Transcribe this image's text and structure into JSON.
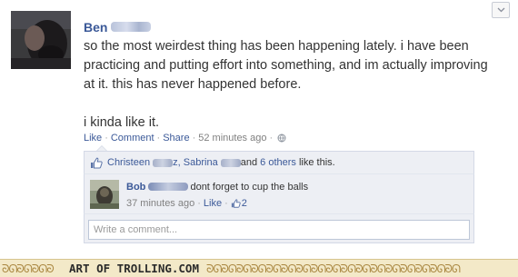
{
  "post": {
    "author_name": "Ben",
    "lines": [
      "so the most weirdest thing has been happening lately. i have been practicing and putting effort into something, and im actually improving at it. this has never happened before.",
      "i kinda like it."
    ],
    "actions": {
      "like": "Like",
      "comment": "Comment",
      "share": "Share",
      "timestamp": "52 minutes ago"
    }
  },
  "likes": {
    "name1": "Christeen",
    "name1_tail": "z,",
    "name2": "Sabrina",
    "name2_tail": "and",
    "others": "6 others",
    "suffix": "like this."
  },
  "comment": {
    "author": "Bob",
    "text": "dont forget to cup the balls",
    "timestamp": "37 minutes ago",
    "like": "Like",
    "like_count": "2"
  },
  "composer": {
    "placeholder": "Write a comment..."
  },
  "footer": {
    "brand": "ART OF TROLLING.COM",
    "ornament_left": "ᘐᘏᘐᘏᘐᘏᘐ",
    "ornament_right": "ᘐᘏᘐᘏᘐᘏᘐᘏᘐᘏᘐᘏᘐᘏᘐᘏᘐᘏᘐᘏᘐᘏᘐᘏᘐᘏᘐᘏᘐᘏᘐᘏᘐᘏ"
  },
  "colors": {
    "link": "#3b5998",
    "ufi_background": "#edeff4",
    "footer_background": "#f3e9c8"
  },
  "icons": {
    "collapse": "chevron-down-icon",
    "privacy": "globe-icon",
    "like": "thumbs-up-icon"
  }
}
